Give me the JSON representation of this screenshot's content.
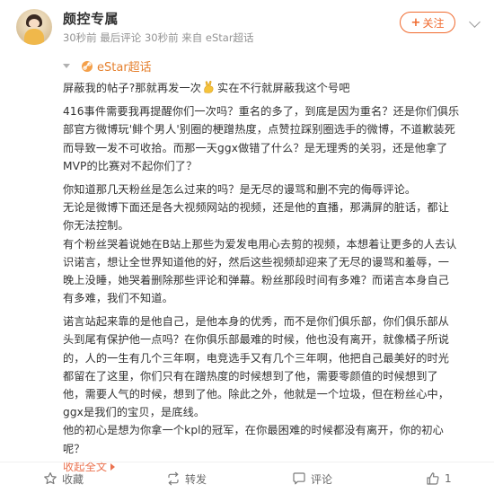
{
  "post": {
    "username": "颇控专属",
    "meta": "30秒前  最后评论 30秒前  来自 eStar超话",
    "follow_label": "关注",
    "source_label": "eStar超话",
    "colors": {
      "accent": "#f06a2e",
      "link": "#eb7350",
      "meta": "#939393"
    },
    "lines": [
      "屏蔽我的帖子?那就再发一次",
      "实在不行就屏蔽我这个号吧",
      "416事件需要我再提醒你们一次吗？重名的多了，到底是因为重名？还是你们俱乐",
      "部官方微博玩'鲱个男人'别圈的梗蹭热度，点赞拉踩别圈选手的微博，不道歉装死",
      "而导致一发不可收拾。而那一天ggx做错了什么？是无理秀的关羽，还是他拿了",
      "MVP的比赛对不起你们了？",
      "你知道那几天粉丝是怎么过来的吗？是无尽的谩骂和删不完的侮辱评论。",
      "无论是微博下面还是各大视频网站的视频，还是他的直播，那满屏的脏话，都让",
      "你无法控制。",
      "有个粉丝哭着说她在B站上那些为爱发电用心去剪的视频，本想着让更多的人去认",
      "识诺言，想让全世界知道他的好，然后这些视频却迎来了无尽的谩骂和羞辱，一",
      "晚上没睡，她哭着删除那些评论和弹幕。粉丝那段时间有多难？而诺言本身自己",
      "有多难，我们不知道。",
      "诺言站起来靠的是他自己，是他本身的优秀，而不是你们俱乐部，你们俱乐部从",
      "头到尾有保护他一点吗？在你俱乐部最难的时候，他也没有离开，就像橘子所说",
      "的，人的一生有几个三年啊，电竞选手又有几个三年啊，他把自己最美好的时光",
      "都留在了这里，你们只有在蹭热度的时候想到了他，需要零颜值的时候想到了",
      "他，需要人气的时候，想到了他。除此之外，他就是一个垃圾，但在粉丝心中，",
      "ggx是我们的宝贝，是底线。",
      "他的初心是想为你拿一个kpl的冠军，在你最困难的时候都没有离开，你的初心",
      "呢？"
    ],
    "expand_label": "收起全文",
    "actions": {
      "favorite": "收藏",
      "repost": "转发",
      "comment": "评论",
      "like": "1"
    }
  }
}
